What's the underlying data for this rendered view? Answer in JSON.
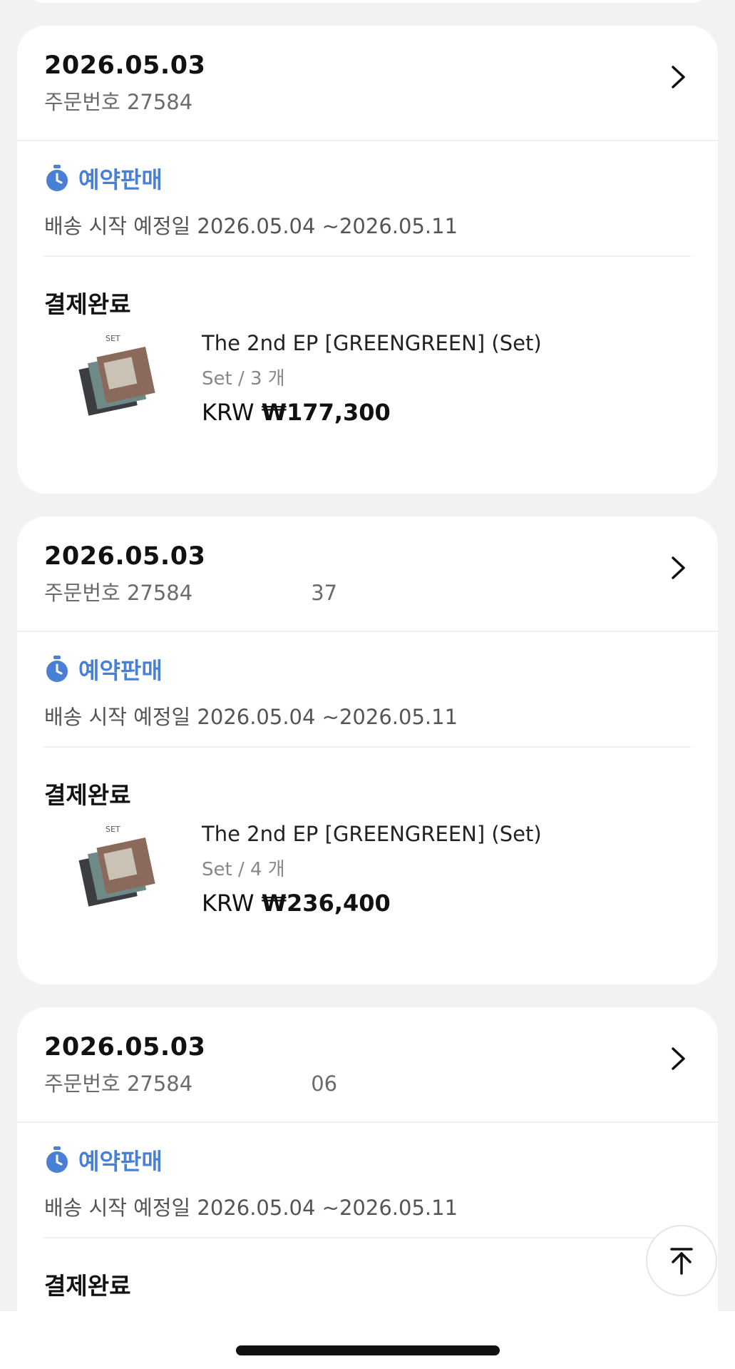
{
  "orders": [
    {
      "date": "2026.05.03",
      "order_number": "주문번호 27584",
      "presale_label": "예약판매",
      "ship_date": "배송 시작 예정일 2026.05.04 ~2026.05.11",
      "status": "결제완료",
      "product": {
        "thumb_label": "SET",
        "title": "The 2nd EP [GREENGREEN] (Set)",
        "qty": "Set / 3 개",
        "currency": "KRW",
        "price": "₩177,300"
      }
    },
    {
      "date": "2026.05.03",
      "order_number": "주문번호 27584",
      "order_number_tail": "37",
      "presale_label": "예약판매",
      "ship_date": "배송 시작 예정일 2026.05.04 ~2026.05.11",
      "status": "결제완료",
      "product": {
        "thumb_label": "SET",
        "title": "The 2nd EP [GREENGREEN] (Set)",
        "qty": "Set / 4 개",
        "currency": "KRW",
        "price": "₩236,400"
      }
    },
    {
      "date": "2026.05.03",
      "order_number": "주문번호 27584",
      "order_number_tail": "06",
      "presale_label": "예약판매",
      "ship_date": "배송 시작 예정일 2026.05.04 ~2026.05.11",
      "status": "결제완료"
    }
  ],
  "colors": {
    "accent": "#4a7fd6",
    "background": "#f1f2f4",
    "card": "#ffffff"
  },
  "icons": [
    "chevron-right-icon",
    "timer-icon",
    "scroll-to-top-icon"
  ]
}
